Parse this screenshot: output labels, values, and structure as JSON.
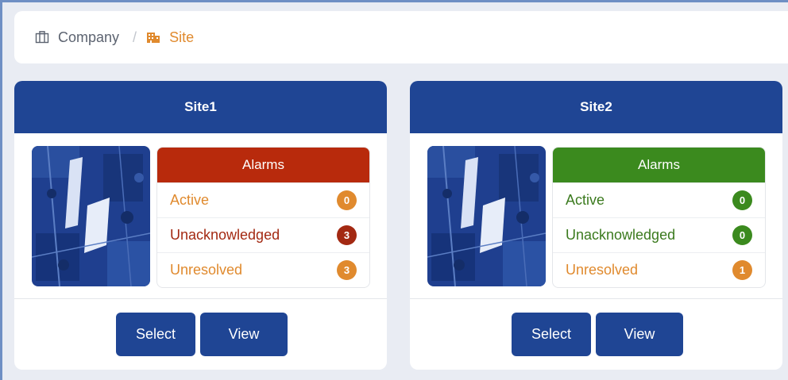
{
  "breadcrumb": {
    "company": {
      "label": "Company",
      "icon": "briefcase-icon",
      "color": "#5c6370"
    },
    "separator": "/",
    "site": {
      "label": "Site",
      "icon": "building-icon",
      "color": "#e08a2e"
    }
  },
  "colors": {
    "primary": "#1f4594",
    "alarm_red": "#b82a0c",
    "alarm_green": "#3b8a1e",
    "orange": "#e08a2e",
    "dark_red": "#a32912"
  },
  "sites": [
    {
      "title": "Site1",
      "alarms_title": "Alarms",
      "alarms_header_color": "#b82a0c",
      "rows": [
        {
          "label": "Active",
          "count": "0",
          "text_color": "#e08a2e",
          "badge_color": "#e08a2e"
        },
        {
          "label": "Unacknowledged",
          "count": "3",
          "text_color": "#a32912",
          "badge_color": "#a32912"
        },
        {
          "label": "Unresolved",
          "count": "3",
          "text_color": "#e08a2e",
          "badge_color": "#e08a2e"
        }
      ],
      "select_label": "Select",
      "view_label": "View"
    },
    {
      "title": "Site2",
      "alarms_title": "Alarms",
      "alarms_header_color": "#3b8a1e",
      "rows": [
        {
          "label": "Active",
          "count": "0",
          "text_color": "#3b7a1e",
          "badge_color": "#3b8a1e"
        },
        {
          "label": "Unacknowledged",
          "count": "0",
          "text_color": "#3b7a1e",
          "badge_color": "#3b8a1e"
        },
        {
          "label": "Unresolved",
          "count": "1",
          "text_color": "#e08a2e",
          "badge_color": "#e08a2e"
        }
      ],
      "select_label": "Select",
      "view_label": "View"
    }
  ]
}
